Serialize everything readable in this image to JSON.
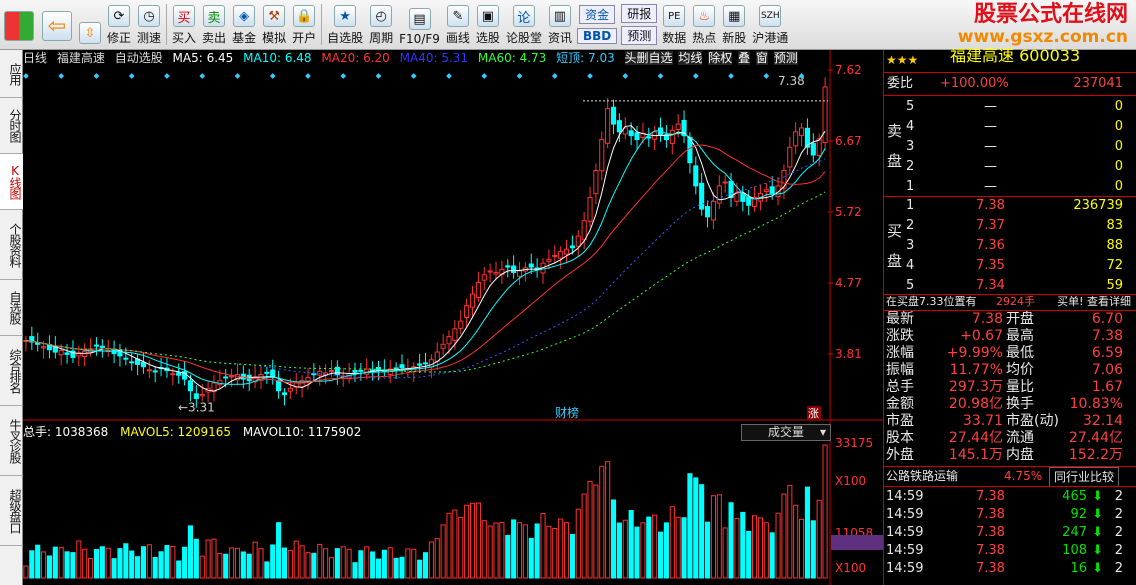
{
  "toolbar": {
    "items": [
      "修正",
      "测速",
      "买入",
      "卖出",
      "基金",
      "模拟",
      "开户",
      "自选股",
      "周期",
      "F10/F9",
      "画线",
      "选股",
      "论股堂",
      "资讯",
      "数据",
      "热点",
      "新股",
      "沪港通"
    ],
    "fund_label": "资金",
    "bbd_label": "BBD",
    "research_label": "研报",
    "forecast_label": "预测"
  },
  "brand": {
    "title": "股票公式在线网",
    "url": "www.gsxz.com.cn"
  },
  "left_tabs": [
    "应用",
    "分时图",
    "K线图",
    "个股资料",
    "自选股",
    "综合排名",
    "牛叉诊股",
    "超级盘口"
  ],
  "chart": {
    "period": "日线",
    "stock_name": "福建高速",
    "auto_select": "自动选股",
    "ma5": "MA5: 6.45",
    "ma10": "MA10: 6.48",
    "ma20": "MA20: 6.20",
    "ma40": "MA40: 5.31",
    "ma60": "MA60: 4.73",
    "short_top": "短顶: 7.03",
    "buttons": [
      "头删自选",
      "均线",
      "除权",
      "叠",
      "窗",
      "预测"
    ],
    "price_axis": [
      "7.62",
      "6.67",
      "5.72",
      "4.77",
      "3.81"
    ],
    "high_label": "7.38",
    "low_label": "3.31",
    "event_label": "财榜",
    "limit_label": "涨",
    "vol_total": "总手: 1038368",
    "mavol5": "MAVOL5: 1209165",
    "mavol10": "MAVOL10: 1175902",
    "vol_select": "成交量",
    "vol_axis": [
      "33175",
      "X100",
      "11058",
      "7791",
      "X100"
    ],
    "chart_data": {
      "type": "candlestick",
      "price_range": [
        3.2,
        7.6
      ],
      "highlight_high": 7.38,
      "highlight_low": 3.31,
      "closes": [
        4.1,
        4.08,
        4.05,
        4.02,
        3.98,
        3.95,
        3.97,
        3.92,
        3.88,
        3.94,
        3.96,
        3.99,
        4.03,
        4.01,
        3.97,
        3.93,
        3.9,
        3.86,
        3.82,
        3.79,
        3.76,
        3.72,
        3.7,
        3.74,
        3.71,
        3.67,
        3.65,
        3.6,
        3.45,
        3.35,
        3.4,
        3.48,
        3.55,
        3.58,
        3.62,
        3.64,
        3.66,
        3.6,
        3.58,
        3.63,
        3.66,
        3.68,
        3.62,
        3.45,
        3.4,
        3.48,
        3.55,
        3.58,
        3.62,
        3.66,
        3.7,
        3.68,
        3.71,
        3.66,
        3.64,
        3.67,
        3.69,
        3.71,
        3.73,
        3.7,
        3.72,
        3.71,
        3.73,
        3.74,
        3.75,
        3.74,
        3.76,
        3.78,
        3.8,
        3.85,
        3.95,
        4.05,
        4.15,
        4.25,
        4.35,
        4.55,
        4.7,
        4.85,
        4.95,
        5.0,
        4.98,
        5.02,
        5.05,
        4.98,
        5.0,
        5.04,
        5.05,
        5.02,
        5.1,
        5.15,
        5.2,
        5.25,
        5.28,
        5.3,
        5.45,
        5.65,
        5.95,
        6.3,
        6.7,
        7.1,
        6.9,
        6.8,
        6.85,
        6.75,
        6.7,
        6.78,
        6.72,
        6.8,
        6.76,
        6.7,
        6.82,
        6.9,
        6.75,
        6.4,
        6.1,
        5.8,
        5.7,
        5.9,
        6.1,
        6.15,
        5.95,
        6.0,
        5.9,
        5.85,
        5.95,
        6.0,
        6.05,
        6.0,
        6.1,
        6.3,
        6.6,
        6.8,
        6.85,
        6.6,
        6.5,
        6.71,
        7.38
      ]
    }
  },
  "panel": {
    "stars": "★★★",
    "name": "福建高速 600033",
    "ratio_label": "委比",
    "ratio_value": "+100.00%",
    "ratio_vol": "237041",
    "sell_label": "卖盘",
    "buy_label": "买盘",
    "asks": [
      [
        "5",
        "—",
        "0"
      ],
      [
        "4",
        "—",
        "0"
      ],
      [
        "3",
        "—",
        "0"
      ],
      [
        "2",
        "—",
        "0"
      ],
      [
        "1",
        "—",
        "0"
      ]
    ],
    "bids": [
      [
        "1",
        "7.38",
        "236739"
      ],
      [
        "2",
        "7.37",
        "83"
      ],
      [
        "3",
        "7.36",
        "88"
      ],
      [
        "4",
        "7.35",
        "72"
      ],
      [
        "5",
        "7.34",
        "59"
      ]
    ],
    "notice": "在买盘7.33位置有",
    "notice_vol": "2924手",
    "notice_link": "买单! 查看详细",
    "quote": [
      [
        "最新",
        "7.38",
        "开盘",
        "6.70"
      ],
      [
        "涨跌",
        "+0.67",
        "最高",
        "7.38"
      ],
      [
        "涨幅",
        "+9.99%",
        "最低",
        "6.59"
      ],
      [
        "振幅",
        "11.77%",
        "均价",
        "7.06"
      ],
      [
        "总手",
        "297.3万",
        "量比",
        "1.67"
      ],
      [
        "金额",
        "20.98亿",
        "换手",
        "10.83%"
      ],
      [
        "市盈",
        "33.71",
        "市盈(动)",
        "32.14"
      ],
      [
        "股本",
        "27.44亿",
        "流通",
        "27.44亿"
      ],
      [
        "外盘",
        "145.1万",
        "内盘",
        "152.2万"
      ]
    ],
    "industry": "公路铁路运输",
    "industry_pct": "4.75%",
    "industry_btn": "同行业比较",
    "ticks": [
      [
        "14:59",
        "7.38",
        "465",
        "2"
      ],
      [
        "14:59",
        "7.38",
        "92",
        "2"
      ],
      [
        "14:59",
        "7.38",
        "247",
        "2"
      ],
      [
        "14:59",
        "7.38",
        "108",
        "2"
      ],
      [
        "14:59",
        "7.38",
        "16",
        "2"
      ]
    ]
  }
}
